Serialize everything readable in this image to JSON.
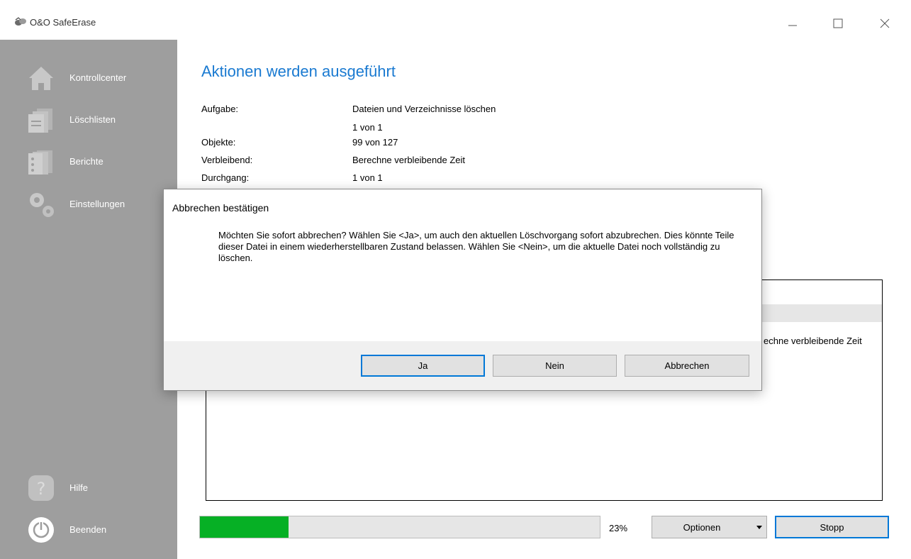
{
  "window": {
    "title": "O&O SafeErase",
    "icons": {
      "app": "app-logo-icon",
      "minimize": "minimize-icon",
      "maximize": "maximize-icon",
      "close": "close-icon"
    }
  },
  "sidebar": {
    "items": [
      {
        "label": "Kontrollcenter",
        "icon": "home-icon"
      },
      {
        "label": "Löschlisten",
        "icon": "delete-lists-icon"
      },
      {
        "label": "Berichte",
        "icon": "reports-icon"
      },
      {
        "label": "Einstellungen",
        "icon": "gears-icon"
      }
    ],
    "bottom": [
      {
        "label": "Hilfe",
        "icon": "help-icon"
      },
      {
        "label": "Beenden",
        "icon": "power-icon"
      }
    ]
  },
  "main": {
    "title": "Aktionen werden ausgeführt",
    "task_label": "Aufgabe:",
    "task_value": "Dateien und Verzeichnisse löschen",
    "task_count": "1 von 1",
    "objects_label": "Objekte:",
    "objects_value": "99 von 127",
    "remaining_label": "Verbleibend:",
    "remaining_value": "Berechne verbleibende Zeit",
    "pass_label": "Durchgang:",
    "pass_value": "1 von 1",
    "list_text": "echne verbleibende Zeit",
    "progress": {
      "percent": 23,
      "label": "23%"
    },
    "options_label": "Optionen",
    "stop_label": "Stopp"
  },
  "dialog": {
    "title": "Abbrechen bestätigen",
    "message": "Möchten Sie sofort abbrechen? Wählen Sie <Ja>, um auch den aktuellen Löschvorgang sofort abzubrechen. Dies könnte Teile dieser Datei in einem wiederherstellbaren Zustand belassen. Wählen Sie <Nein>, um die aktuelle Datei noch vollständig zu löschen.",
    "yes_label": "Ja",
    "no_label": "Nein",
    "cancel_label": "Abbrechen"
  },
  "colors": {
    "accent": "#1a7ad1",
    "sidebar": "#9e9e9e",
    "progress": "#06b025",
    "focus_border": "#0078d7"
  }
}
